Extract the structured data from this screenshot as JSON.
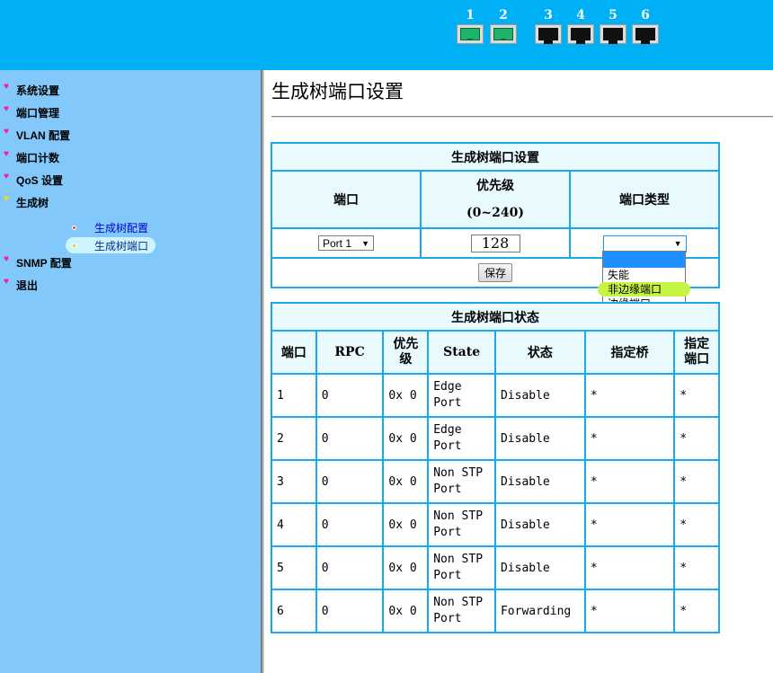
{
  "header": {
    "ports": [
      {
        "number": "1",
        "status": "up"
      },
      {
        "number": "2",
        "status": "up"
      },
      {
        "number": "3",
        "status": "down"
      },
      {
        "number": "4",
        "status": "down"
      },
      {
        "number": "5",
        "status": "down"
      },
      {
        "number": "6",
        "status": "down"
      }
    ]
  },
  "sidebar": {
    "items": [
      {
        "label": "系统设置"
      },
      {
        "label": "端口管理"
      },
      {
        "label": "VLAN 配置"
      },
      {
        "label": "端口计数"
      },
      {
        "label": "QoS 设置"
      },
      {
        "label": "生成树"
      },
      {
        "label": "SNMP 配置"
      },
      {
        "label": "退出"
      }
    ],
    "subitems": [
      {
        "label": "生成树配置"
      },
      {
        "label": "生成树端口"
      }
    ]
  },
  "main": {
    "title": "生成树端口设置",
    "config": {
      "caption": "生成树端口设置",
      "col_port": "端口",
      "col_priority": "优先级",
      "col_priority_range": "(0~240)",
      "col_type": "端口类型",
      "port_select_value": "Port 1",
      "priority_value": "128",
      "type_select_value": "",
      "type_options": [
        "",
        "失能",
        "非边缘端口",
        "边缘端口"
      ],
      "save_label": "保存"
    },
    "status": {
      "caption": "生成树端口状态",
      "headers": {
        "port": "端口",
        "rpc": "RPC",
        "priority_1": "优先",
        "priority_2": "级",
        "state": "State",
        "status": "状态",
        "bridge": "指定桥",
        "dport_1": "指定",
        "dport_2": "端口"
      },
      "rows": [
        {
          "port": "1",
          "rpc": "0",
          "priority": "0x 0",
          "state_1": "Edge",
          "state_2": "Port",
          "status": "Disable",
          "bridge": "*",
          "dport": "*"
        },
        {
          "port": "2",
          "rpc": "0",
          "priority": "0x 0",
          "state_1": "Edge",
          "state_2": "Port",
          "status": "Disable",
          "bridge": "*",
          "dport": "*"
        },
        {
          "port": "3",
          "rpc": "0",
          "priority": "0x 0",
          "state_1": "Non STP",
          "state_2": "Port",
          "status": "Disable",
          "bridge": "*",
          "dport": "*"
        },
        {
          "port": "4",
          "rpc": "0",
          "priority": "0x 0",
          "state_1": "Non STP",
          "state_2": "Port",
          "status": "Disable",
          "bridge": "*",
          "dport": "*"
        },
        {
          "port": "5",
          "rpc": "0",
          "priority": "0x 0",
          "state_1": "Non STP",
          "state_2": "Port",
          "status": "Disable",
          "bridge": "*",
          "dport": "*"
        },
        {
          "port": "6",
          "rpc": "0",
          "priority": "0x 0",
          "state_1": "Non STP",
          "state_2": "Port",
          "status": "Forwarding",
          "bridge": "*",
          "dport": "*"
        }
      ]
    }
  }
}
